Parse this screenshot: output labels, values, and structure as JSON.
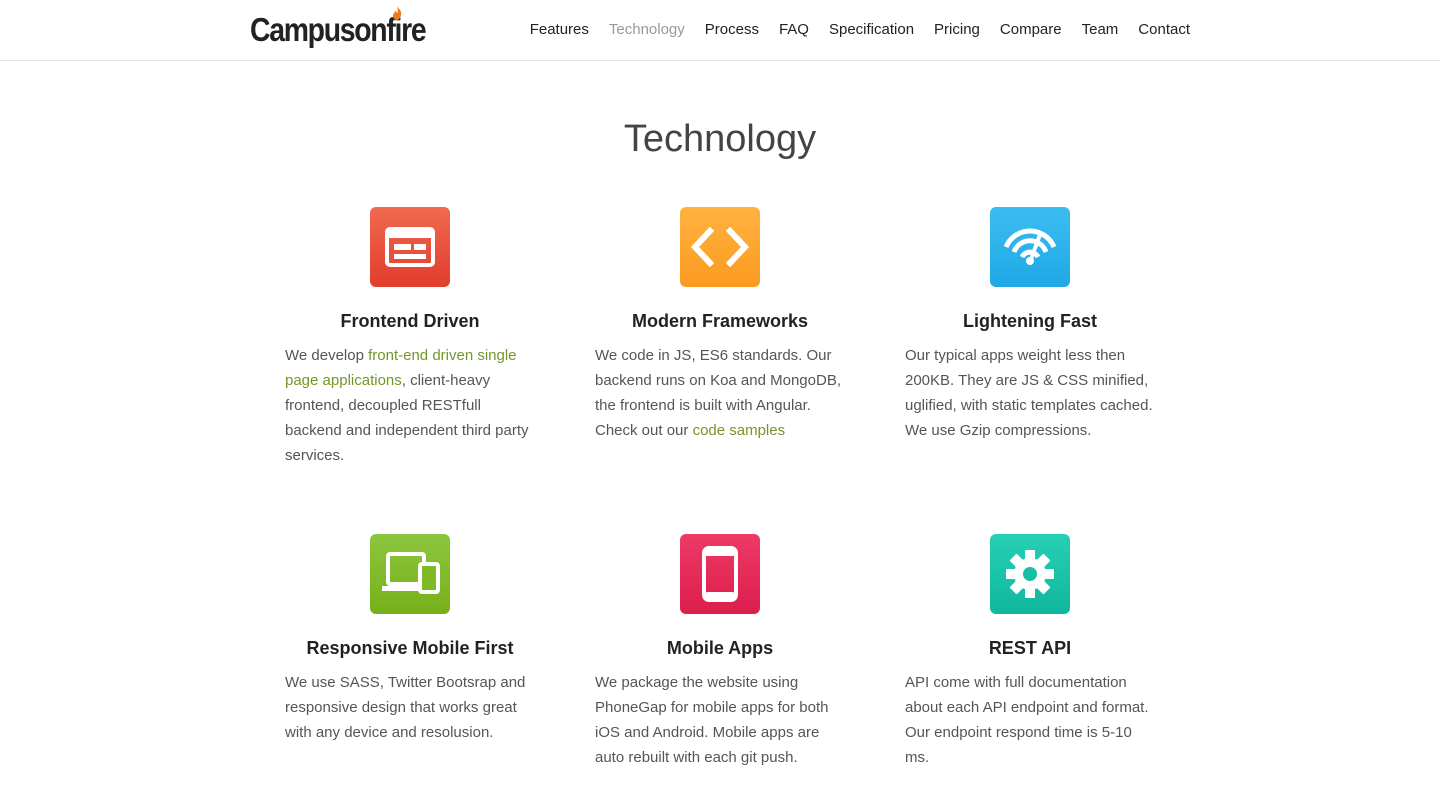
{
  "brand": {
    "name": "Campusonfire"
  },
  "nav": {
    "items": [
      {
        "label": "Features",
        "active": false
      },
      {
        "label": "Technology",
        "active": true
      },
      {
        "label": "Process",
        "active": false
      },
      {
        "label": "FAQ",
        "active": false
      },
      {
        "label": "Specification",
        "active": false
      },
      {
        "label": "Pricing",
        "active": false
      },
      {
        "label": "Compare",
        "active": false
      },
      {
        "label": "Team",
        "active": false
      },
      {
        "label": "Contact",
        "active": false
      }
    ]
  },
  "section": {
    "title": "Technology"
  },
  "features": [
    {
      "title": "Frontend Driven",
      "icon": "browser-layout-icon",
      "color_top": "#f06a50",
      "color_bottom": "#e23d2c",
      "text_before": "We develop ",
      "link": "front-end driven single page applications",
      "text_after": ", client-heavy frontend, decoupled RESTfull backend and independent third party services."
    },
    {
      "title": "Modern Frameworks",
      "icon": "code-brackets-icon",
      "color_top": "#ffb340",
      "color_bottom": "#fb9a20",
      "text_before": "We code in JS, ES6 standards. Our backend runs on Koa and MongoDB, the frontend is built with Angular. Check out our ",
      "link": "code samples",
      "text_after": ""
    },
    {
      "title": "Lightening Fast",
      "icon": "speedometer-icon",
      "color_top": "#3cbdf0",
      "color_bottom": "#1ea8e6",
      "text_before": "Our typical apps weight less then 200KB. They are JS & CSS minified, uglified, with static templates cached. We use Gzip compressions.",
      "link": "",
      "text_after": ""
    },
    {
      "title": "Responsive Mobile First",
      "icon": "devices-icon",
      "color_top": "#8cc63f",
      "color_bottom": "#77b019",
      "text_before": "We use SASS, Twitter Bootsrap and responsive design that works great with any device and resolusion.",
      "link": "",
      "text_after": ""
    },
    {
      "title": "Mobile Apps",
      "icon": "smartphone-icon",
      "color_top": "#ee3a66",
      "color_bottom": "#dc1e4d",
      "text_before": "We package the website using PhoneGap for mobile apps for both iOS and Android. Mobile apps are auto rebuilt with each git push.",
      "link": "",
      "text_after": ""
    },
    {
      "title": "REST API",
      "icon": "gear-icon",
      "color_top": "#27cfb5",
      "color_bottom": "#0fb79d",
      "text_before": "API come with full documentation about each API endpoint and format. Our endpoint respond time is 5-10 ms.",
      "link": "",
      "text_after": ""
    }
  ]
}
